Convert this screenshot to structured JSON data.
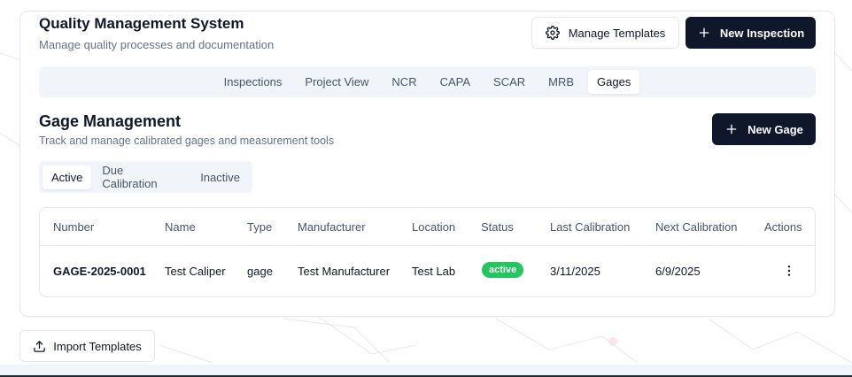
{
  "header": {
    "title": "Quality Management System",
    "subtitle": "Manage quality processes and documentation",
    "manage_templates_label": "Manage Templates",
    "new_inspection_label": "New Inspection"
  },
  "tabs": [
    {
      "label": "Inspections",
      "active": false
    },
    {
      "label": "Project View",
      "active": false
    },
    {
      "label": "NCR",
      "active": false
    },
    {
      "label": "CAPA",
      "active": false
    },
    {
      "label": "SCAR",
      "active": false
    },
    {
      "label": "MRB",
      "active": false
    },
    {
      "label": "Gages",
      "active": true
    }
  ],
  "gage_section": {
    "title": "Gage Management",
    "subtitle": "Track and manage calibrated gages and measurement tools",
    "new_gage_label": "New Gage",
    "subtabs": [
      {
        "label": "Active",
        "active": true
      },
      {
        "label": "Due Calibration",
        "active": false
      },
      {
        "label": "Inactive",
        "active": false
      }
    ]
  },
  "table": {
    "columns": [
      "Number",
      "Name",
      "Type",
      "Manufacturer",
      "Location",
      "Status",
      "Last Calibration",
      "Next Calibration",
      "Actions"
    ],
    "rows": [
      {
        "number": "GAGE-2025-0001",
        "name": "Test Caliper",
        "type": "gage",
        "manufacturer": "Test Manufacturer",
        "location": "Test Lab",
        "status": "active",
        "last_calibration": "3/11/2025",
        "next_calibration": "6/9/2025"
      }
    ]
  },
  "footer": {
    "import_templates_label": "Import Templates"
  },
  "colors": {
    "primary_dark": "#0f172a",
    "muted_text": "#64748b",
    "tab_bg": "#f1f5f9",
    "status_active": "#22c55e",
    "border": "#e2e8f0"
  },
  "icons": {
    "manage_templates": "gear-icon",
    "new_inspection": "plus-icon",
    "new_gage": "plus-icon",
    "row_actions": "more-vertical-icon",
    "import_templates": "upload-icon"
  }
}
